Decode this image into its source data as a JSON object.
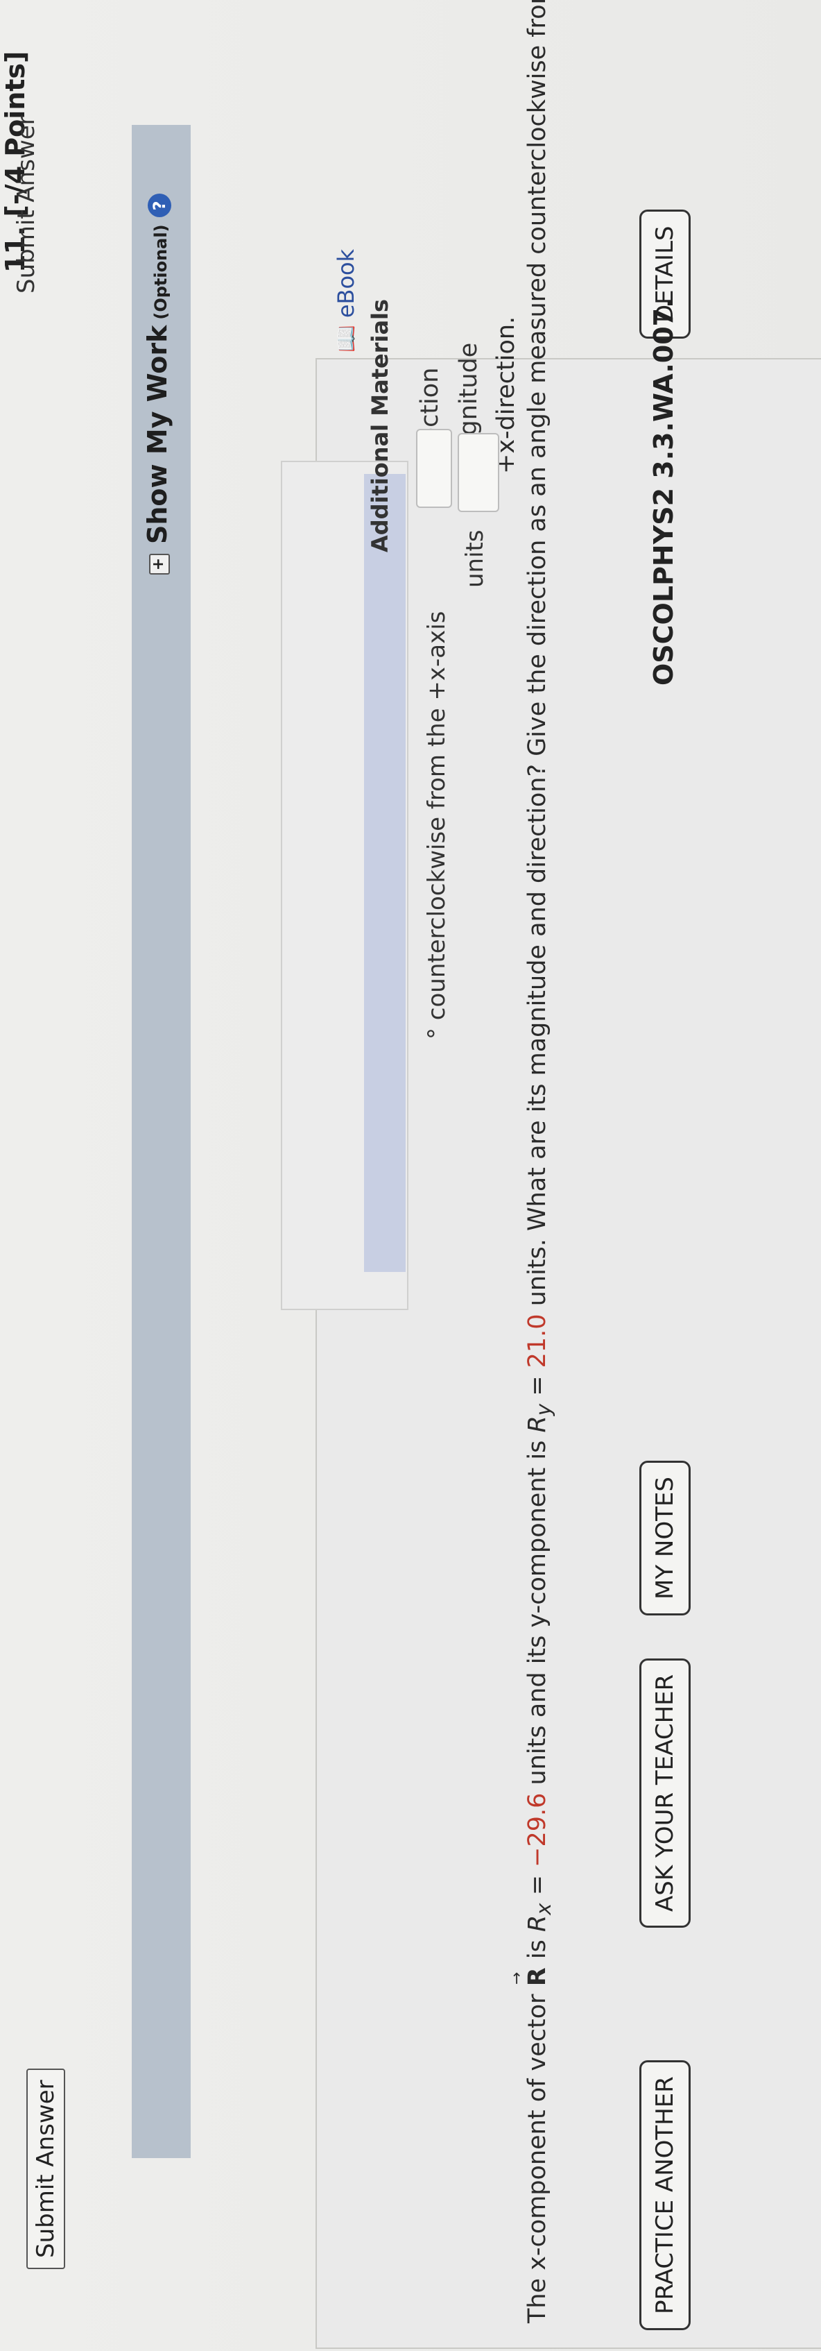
{
  "actions": {
    "submit_answer": "Submit Answer",
    "submit_answer_cut": "Submit Answer"
  },
  "question": {
    "number_points": "11.  [-/4 Points]",
    "details_button": "DETAILS",
    "problem_id": "OSCOLPHYS2 3.3.WA.007.",
    "my_notes_button": "MY NOTES",
    "ask_teacher_button": "ASK YOUR TEACHER",
    "practice_another_button": "PRACTICE ANOTHER",
    "text_part1": "The x-component of vector",
    "vector_symbol": "R",
    "text_is": "is",
    "rx_symbol": "R",
    "rx_sub": "x",
    "rx_value": "−29.6",
    "text_part2": "units and its y-component is",
    "ry_symbol": "R",
    "ry_sub": "y",
    "ry_value": "21.0",
    "text_part3": "units. What are its magnitude and direction? Give the direction as an angle measured counterclockwise from the",
    "text_line2": "+x-direction.",
    "magnitude_label": "magnitude",
    "magnitude_value": "",
    "magnitude_units": "units",
    "direction_label": "direction",
    "direction_value": "",
    "direction_suffix": "° counterclockwise from the +x-axis",
    "accent_red": "#c0392b"
  },
  "additional_materials": {
    "title": "Additional Materials",
    "ebook_label": "eBook",
    "ebook_icon": "book-icon"
  },
  "show_my_work": {
    "label": "Show My Work",
    "optional": "(Optional)",
    "plus_icon": "+",
    "help_icon": "?"
  }
}
